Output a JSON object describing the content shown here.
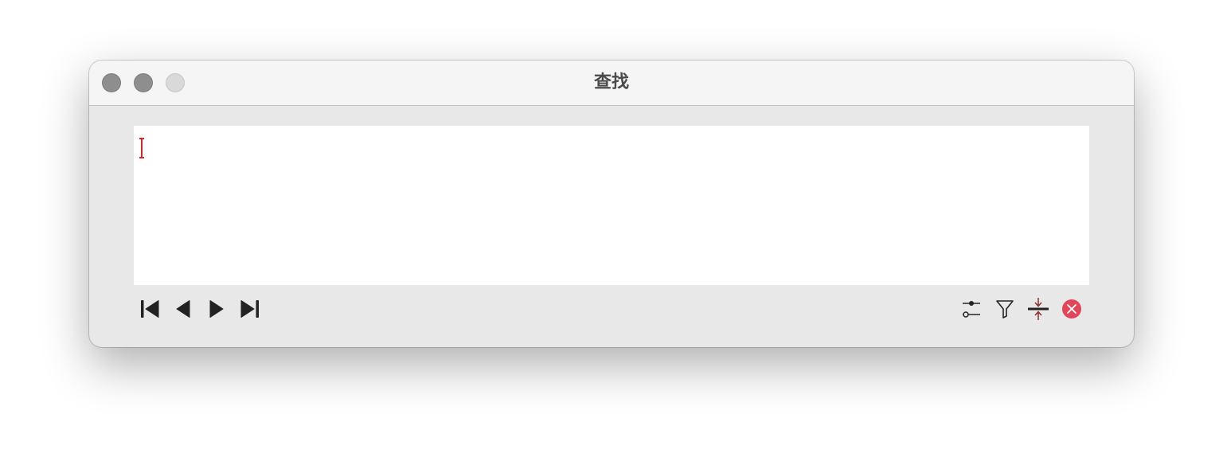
{
  "window": {
    "title": "查找"
  },
  "search": {
    "value": "",
    "placeholder": ""
  },
  "navigation": {
    "icons": [
      "skip-to-first-icon",
      "previous-icon",
      "next-icon",
      "skip-to-last-icon"
    ]
  },
  "actions": {
    "icons": [
      "options-sliders-icon",
      "filter-icon",
      "collapse-icon",
      "close-circle-icon"
    ]
  },
  "colors": {
    "caret": "#e0211f",
    "close_button": "#e0475a",
    "icon": "#222222",
    "collapse_arrows": "#8b2c2c"
  }
}
